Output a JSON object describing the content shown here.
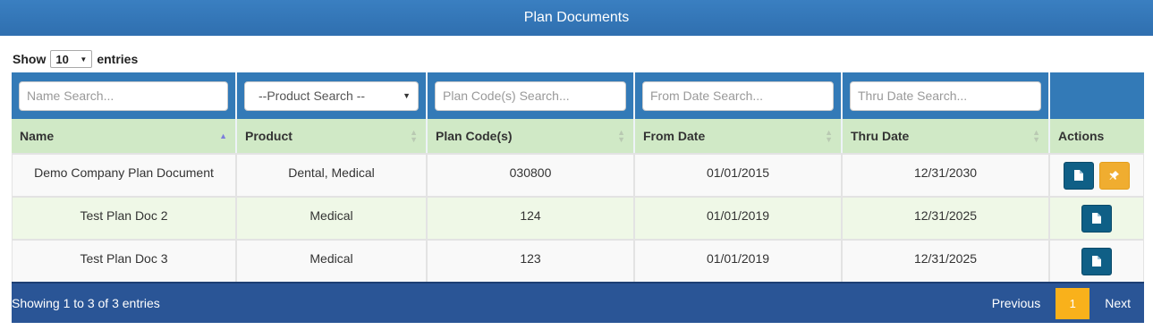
{
  "page": {
    "title": "Plan Documents"
  },
  "length_menu": {
    "prefix": "Show",
    "value": "10",
    "suffix": "entries"
  },
  "filters": {
    "name_placeholder": "Name Search...",
    "product_selected": "--Product Search --",
    "plan_code_placeholder": "Plan Code(s) Search...",
    "from_date_placeholder": "From Date Search...",
    "thru_date_placeholder": "Thru Date Search..."
  },
  "columns": [
    "Name",
    "Product",
    "Plan Code(s)",
    "From Date",
    "Thru Date",
    "Actions"
  ],
  "rows": [
    {
      "name": "Demo Company Plan Document",
      "product": "Dental, Medical",
      "plan_codes": "030800",
      "from_date": "01/01/2015",
      "thru_date": "12/31/2030",
      "actions": [
        "document-icon",
        "pin-icon"
      ]
    },
    {
      "name": "Test Plan Doc 2",
      "product": "Medical",
      "plan_codes": "124",
      "from_date": "01/01/2019",
      "thru_date": "12/31/2025",
      "actions": [
        "document-icon"
      ]
    },
    {
      "name": "Test Plan Doc 3",
      "product": "Medical",
      "plan_codes": "123",
      "from_date": "01/01/2019",
      "thru_date": "12/31/2025",
      "actions": [
        "document-icon"
      ]
    }
  ],
  "footer": {
    "info": "Showing 1 to 3 of 3 entries"
  },
  "pagination": {
    "previous": "Previous",
    "current": "1",
    "next": "Next"
  },
  "colors": {
    "header_blue": "#337ab7",
    "header_green": "#d0e9c6",
    "footer_blue": "#2a5596",
    "accent_orange": "#f9b11b",
    "doc_button": "#0f5f86"
  }
}
